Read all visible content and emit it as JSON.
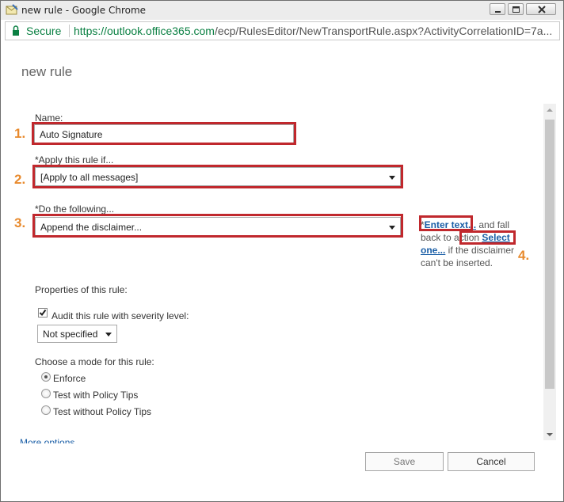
{
  "window": {
    "title": "new rule - Google Chrome"
  },
  "address": {
    "secure_label": "Secure",
    "url_host": "https://outlook.office365.com",
    "url_path": "/ecp/RulesEditor/NewTransportRule.aspx?ActivityCorrelationID=7a..."
  },
  "page": {
    "heading": "new rule"
  },
  "form": {
    "name_label": "Name:",
    "name_value": "Auto Signature",
    "apply_label": "*Apply this rule if...",
    "apply_value": "[Apply to all messages]",
    "do_label": "*Do the following...",
    "do_value": "Append the disclaimer...",
    "properties_label": "Properties of this rule:",
    "audit_label": "Audit this rule with severity level:",
    "audit_checked": true,
    "severity_value": "Not specified",
    "mode_label": "Choose a mode for this rule:",
    "modes": [
      {
        "label": "Enforce",
        "selected": true
      },
      {
        "label": "Test with Policy Tips",
        "selected": false
      },
      {
        "label": "Test without Policy Tips",
        "selected": false
      }
    ],
    "more_options_partial": "More options..."
  },
  "disclaimer_side": {
    "prefix": "*",
    "enter_text_link": "Enter text...",
    "text_1": " and fall back to action ",
    "select_one_link": "Select one...",
    "text_2": " if the disclaimer can't be inserted."
  },
  "annotations": {
    "n1": "1.",
    "n2": "2.",
    "n3": "3.",
    "n4": "4.",
    "highlight_color": "#c0282d",
    "number_color": "#e88a2d"
  },
  "buttons": {
    "save": "Save",
    "cancel": "Cancel"
  }
}
